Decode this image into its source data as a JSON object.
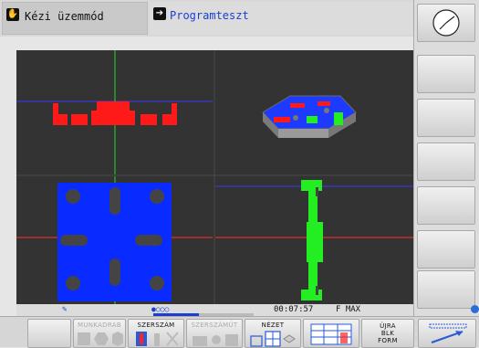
{
  "header": {
    "mode_manual": "Kézi üzemmód",
    "mode_program": "Programteszt"
  },
  "status": {
    "time": "00:07:57",
    "feed": "F MAX"
  },
  "softkeys": {
    "workpiece": "MUNKADRAB",
    "tool": "SZERSZÁM",
    "tool_path": "SZERSZÁMÚT",
    "view": "NÉZET",
    "restart_line1": "ÚJRA",
    "restart_line2": "BLK",
    "restart_line3": "FORM"
  },
  "colors": {
    "accent_blue": "#1a3fd0",
    "graphics_bg": "#333333",
    "part_red": "#ff1a1a",
    "part_blue": "#0a2bff",
    "part_green": "#22ee22"
  }
}
